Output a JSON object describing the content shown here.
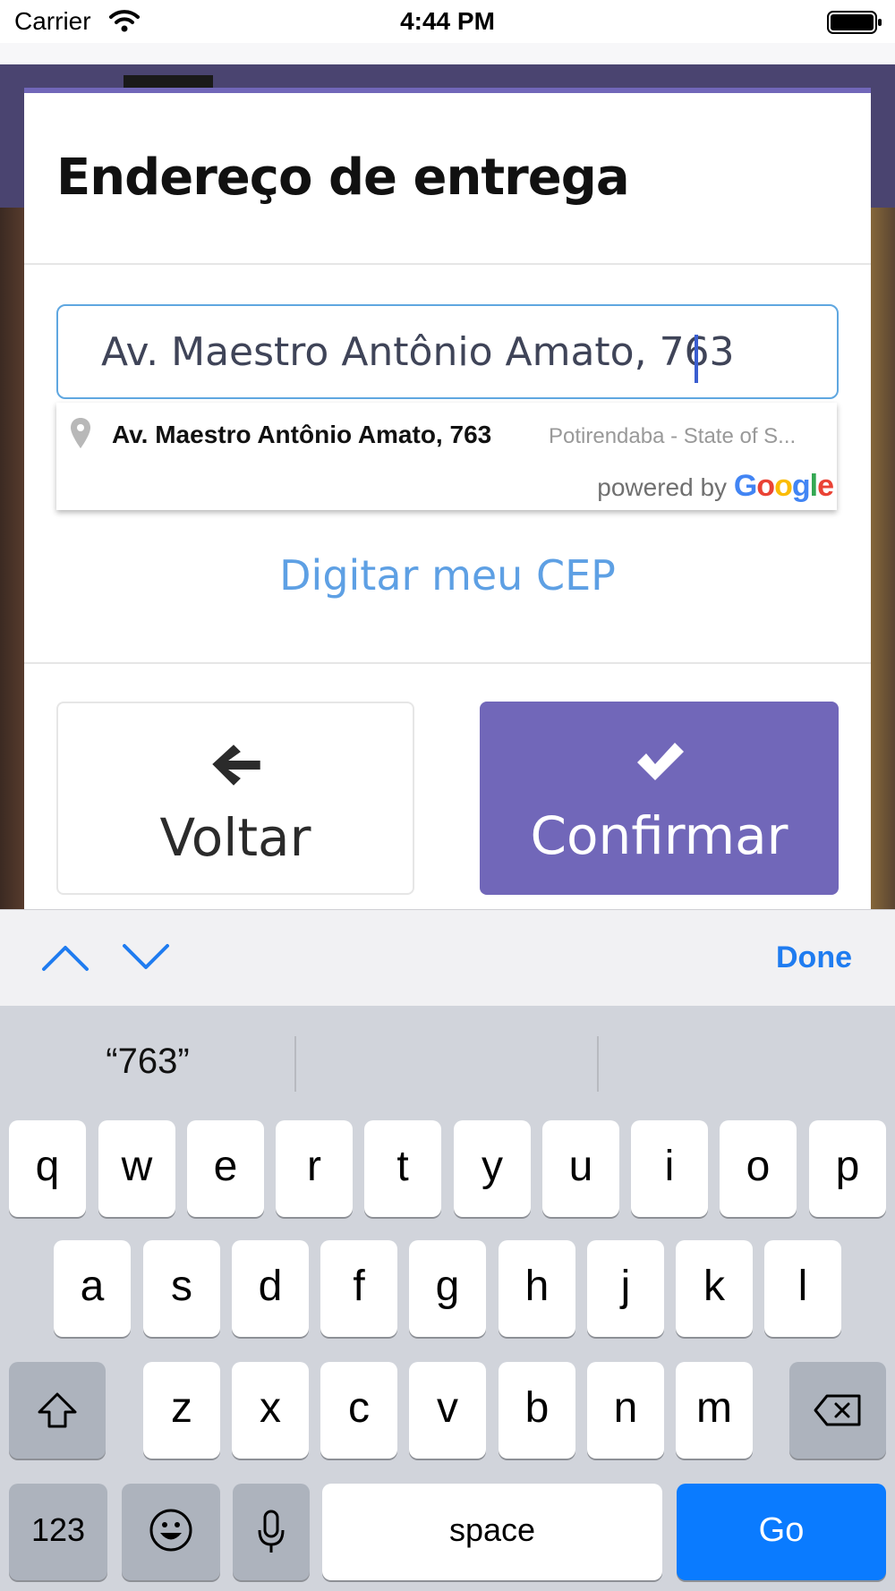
{
  "status_bar": {
    "carrier": "Carrier",
    "time": "4:44 PM"
  },
  "modal": {
    "title": "Endereço de entrega",
    "address_input_value": "Av. Maestro Antônio Amato, 763",
    "suggestion": {
      "main_text": "Av. Maestro Antônio Amato, 763",
      "secondary_text": "Potirendaba - State of S..."
    },
    "powered_by": "powered by",
    "google": [
      "G",
      "o",
      "o",
      "g",
      "l",
      "e"
    ],
    "cep_link": "Digitar meu CEP",
    "back_label": "Voltar",
    "confirm_label": "Confirmar",
    "accent_color": "#7167b9"
  },
  "accessory": {
    "done_label": "Done"
  },
  "keyboard": {
    "predictions": [
      "“763”",
      "",
      ""
    ],
    "row1": [
      "q",
      "w",
      "e",
      "r",
      "t",
      "y",
      "u",
      "i",
      "o",
      "p"
    ],
    "row2": [
      "a",
      "s",
      "d",
      "f",
      "g",
      "h",
      "j",
      "k",
      "l"
    ],
    "row3": [
      "z",
      "x",
      "c",
      "v",
      "b",
      "n",
      "m"
    ],
    "numbers_label": "123",
    "space_label": "space",
    "go_label": "Go"
  }
}
